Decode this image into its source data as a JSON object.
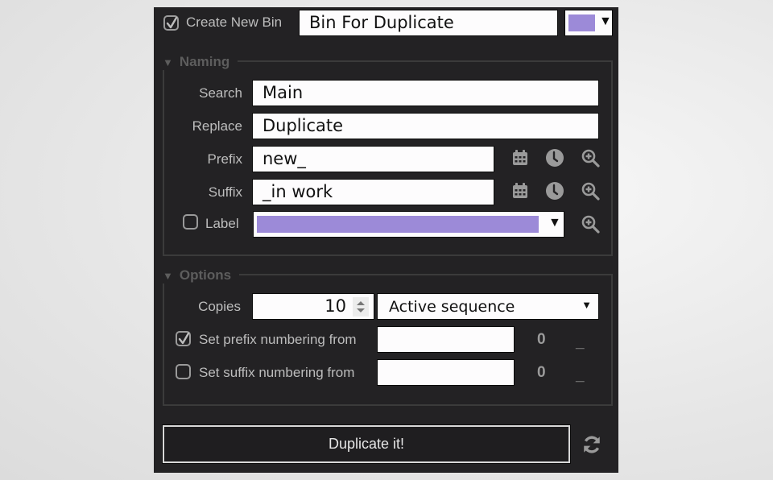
{
  "header": {
    "create_bin_checked": true,
    "create_bin_label": "Create New Bin",
    "bin_name_value": "Bin For Duplicate",
    "bin_color": "#9c8ad8",
    "dropdown_arrow": "▼"
  },
  "naming": {
    "title": "Naming",
    "collapse_arrow": "▼",
    "search_label": "Search",
    "search_value": "Main",
    "replace_label": "Replace",
    "replace_value": "Duplicate",
    "prefix_label": "Prefix",
    "prefix_value": "new_",
    "suffix_label": "Suffix",
    "suffix_value": "_in work",
    "label_checked": false,
    "label_label": "Label",
    "label_color": "#9c8ad8",
    "icons": [
      "calendar-icon",
      "clock-icon",
      "zoom-in-icon"
    ]
  },
  "options": {
    "title": "Options",
    "collapse_arrow": "▼",
    "copies_label": "Copies",
    "copies_value": "10",
    "sequence_select": "Active sequence",
    "prefix_numbering_checked": true,
    "prefix_numbering_label": "Set prefix numbering from",
    "prefix_numbering_value": "",
    "prefix_count": "0",
    "prefix_separator": "_",
    "suffix_numbering_checked": false,
    "suffix_numbering_label": "Set suffix numbering from",
    "suffix_numbering_value": "",
    "suffix_count": "0",
    "suffix_separator": "_"
  },
  "footer": {
    "duplicate_button": "Duplicate it!",
    "refresh_icon": "refresh-icon"
  }
}
